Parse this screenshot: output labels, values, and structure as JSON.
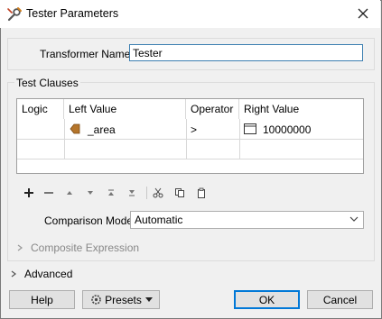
{
  "window": {
    "title": "Tester Parameters",
    "icon": "wrench-tester-icon"
  },
  "transformer_name": {
    "label": "Transformer Name:",
    "value": "Tester"
  },
  "test_clauses": {
    "group_title": "Test Clauses",
    "columns": [
      "Logic",
      "Left Value",
      "Operator",
      "Right Value"
    ],
    "rows": [
      {
        "logic": "",
        "left_value": "_area",
        "operator": ">",
        "right_value": "10000000"
      }
    ]
  },
  "toolbar": {
    "icons": [
      "add-icon",
      "remove-icon",
      "move-up-icon",
      "move-down-icon",
      "move-top-icon",
      "move-bottom-icon",
      "cut-icon",
      "copy-icon",
      "paste-icon"
    ]
  },
  "comparison_mode": {
    "label": "Comparison Mode:",
    "value": "Automatic"
  },
  "composite_expression": {
    "label": "Composite Expression"
  },
  "advanced": {
    "label": "Advanced"
  },
  "buttons": {
    "help": "Help",
    "presets": "Presets",
    "ok": "OK",
    "cancel": "Cancel"
  },
  "colors": {
    "accent": "#0078d7",
    "attribute_icon": "#b5752b"
  }
}
